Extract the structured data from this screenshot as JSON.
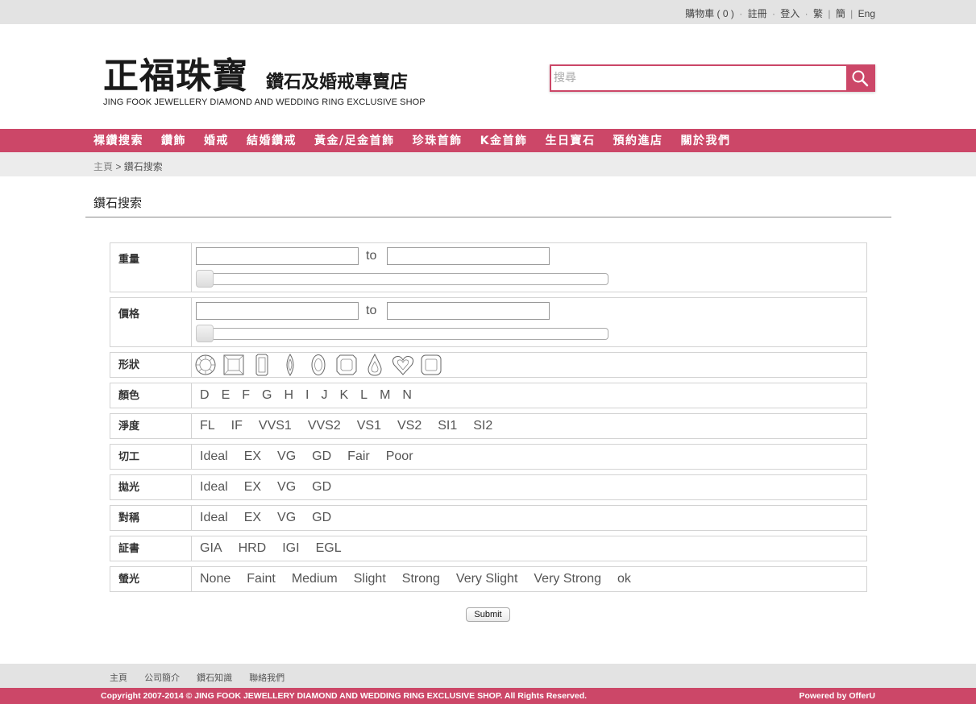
{
  "topbar": {
    "cart": "購物車",
    "cart_count": "( 0 )",
    "register": "註冊",
    "login": "登入",
    "lang_trad": "繁",
    "lang_simp": "簡",
    "lang_eng": "Eng"
  },
  "header": {
    "logo_cn": "正福珠寶",
    "logo_sub": "鑽石及婚戒專賣店",
    "logo_en": "JING FOOK JEWELLERY DIAMOND AND WEDDING RING EXCLUSIVE SHOP",
    "search_placeholder": "搜尋",
    "search_icon": "magnifier-icon"
  },
  "nav": [
    "裸鑽搜索",
    "鑽飾",
    "婚戒",
    "結婚鑽戒",
    "黃金/足金首飾",
    "珍珠首飾",
    "K金首飾",
    "生日寶石",
    "預約進店",
    "關於我們"
  ],
  "breadcrumb": {
    "home": "主頁",
    "separator": ">",
    "current": "鑽石搜索"
  },
  "page_title": "鑽石搜索",
  "form": {
    "weight": {
      "label": "重量",
      "to": "to",
      "slider_value": 0
    },
    "price": {
      "label": "價格",
      "to": "to",
      "slider_value": 0
    },
    "shape": {
      "label": "形狀",
      "shapes": [
        "round-shape-icon",
        "princess-shape-icon",
        "emerald-shape-icon",
        "marquise-shape-icon",
        "oval-shape-icon",
        "radiant-shape-icon",
        "pear-shape-icon",
        "heart-shape-icon",
        "cushion-shape-icon"
      ]
    },
    "color": {
      "label": "顏色",
      "options": [
        "D",
        "E",
        "F",
        "G",
        "H",
        "I",
        "J",
        "K",
        "L",
        "M",
        "N"
      ]
    },
    "clarity": {
      "label": "淨度",
      "options": [
        "FL",
        "IF",
        "VVS1",
        "VVS2",
        "VS1",
        "VS2",
        "SI1",
        "SI2"
      ]
    },
    "cut": {
      "label": "切工",
      "options": [
        "Ideal",
        "EX",
        "VG",
        "GD",
        "Fair",
        "Poor"
      ]
    },
    "polish": {
      "label": "拋光",
      "options": [
        "Ideal",
        "EX",
        "VG",
        "GD"
      ]
    },
    "symmetry": {
      "label": "對稱",
      "options": [
        "Ideal",
        "EX",
        "VG",
        "GD"
      ]
    },
    "certificate": {
      "label": "証書",
      "options": [
        "GIA",
        "HRD",
        "IGI",
        "EGL"
      ]
    },
    "fluorescence": {
      "label": "螢光",
      "options": [
        "None",
        "Faint",
        "Medium",
        "Slight",
        "Strong",
        "Very Slight",
        "Very Strong",
        "ok"
      ]
    },
    "submit": "Submit"
  },
  "footer": {
    "links": [
      "主頁",
      "公司簡介",
      "鑽石知識",
      "聯絡我們"
    ],
    "copyright": "Copyright 2007-2014 © JING FOOK JEWELLERY DIAMOND AND WEDDING RING EXCLUSIVE SHOP. All Rights Reserved.",
    "powered": "Powered by OfferU"
  },
  "colors": {
    "brand": "#cc4768",
    "topbar": "#e3e3e3",
    "crumbbar": "#ececec"
  }
}
